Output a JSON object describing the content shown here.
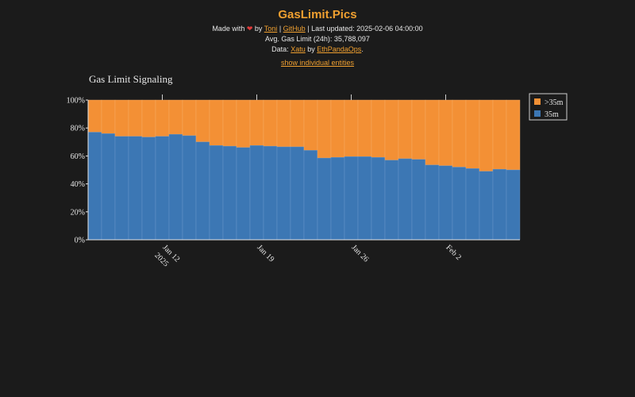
{
  "header": {
    "title": "GasLimit.Pics",
    "made_with": "Made with",
    "by": "by",
    "author_link": "Toni",
    "sep1": "|",
    "github_link": "GitHub",
    "sep2": "|",
    "last_updated": "Last updated: 2025-02-06 04:00:00",
    "avg_gas": "Avg. Gas Limit (24h): 35,788,097",
    "data_label": "Data:",
    "xatu_link": "Xatu",
    "by2": "by",
    "ethpanda_link": "EthPandaOps",
    "period": ".",
    "show_entities": "show individual entities"
  },
  "colors": {
    "above": "#f39035",
    "base": "#3c77b4",
    "background": "#1b1b1b",
    "accent": "#f0a030"
  },
  "chart_data": {
    "type": "bar",
    "stacked": true,
    "title": "Gas Limit Signaling",
    "ylim": [
      0,
      100
    ],
    "y_ticks": [
      "0%",
      "20%",
      "40%",
      "60%",
      "80%",
      "100%"
    ],
    "x_ticks": [
      "Jan 12",
      "2025",
      "Jan 19",
      "Jan 26",
      "Feb 2"
    ],
    "legend_position": "top-right",
    "legend": [
      ">35m",
      "35m"
    ],
    "series": [
      {
        "name": "35m",
        "values": [
          77,
          76,
          74,
          74,
          73.5,
          74,
          75.5,
          74.5,
          70,
          67.5,
          67,
          66,
          67.5,
          67,
          66.5,
          66.5,
          64,
          58.5,
          59,
          59.5,
          59.5,
          59,
          57,
          58,
          57.5,
          53.5,
          53,
          52,
          51,
          49,
          50.5,
          50
        ]
      },
      {
        "name": ">35m",
        "values": [
          23,
          24,
          26,
          26,
          26.5,
          26,
          24.5,
          25.5,
          30,
          32.5,
          33,
          34,
          32.5,
          33,
          33.5,
          33.5,
          36,
          41.5,
          41,
          40.5,
          40.5,
          41,
          43,
          42,
          42.5,
          46.5,
          47,
          48,
          49,
          51,
          49.5,
          50
        ]
      }
    ]
  }
}
